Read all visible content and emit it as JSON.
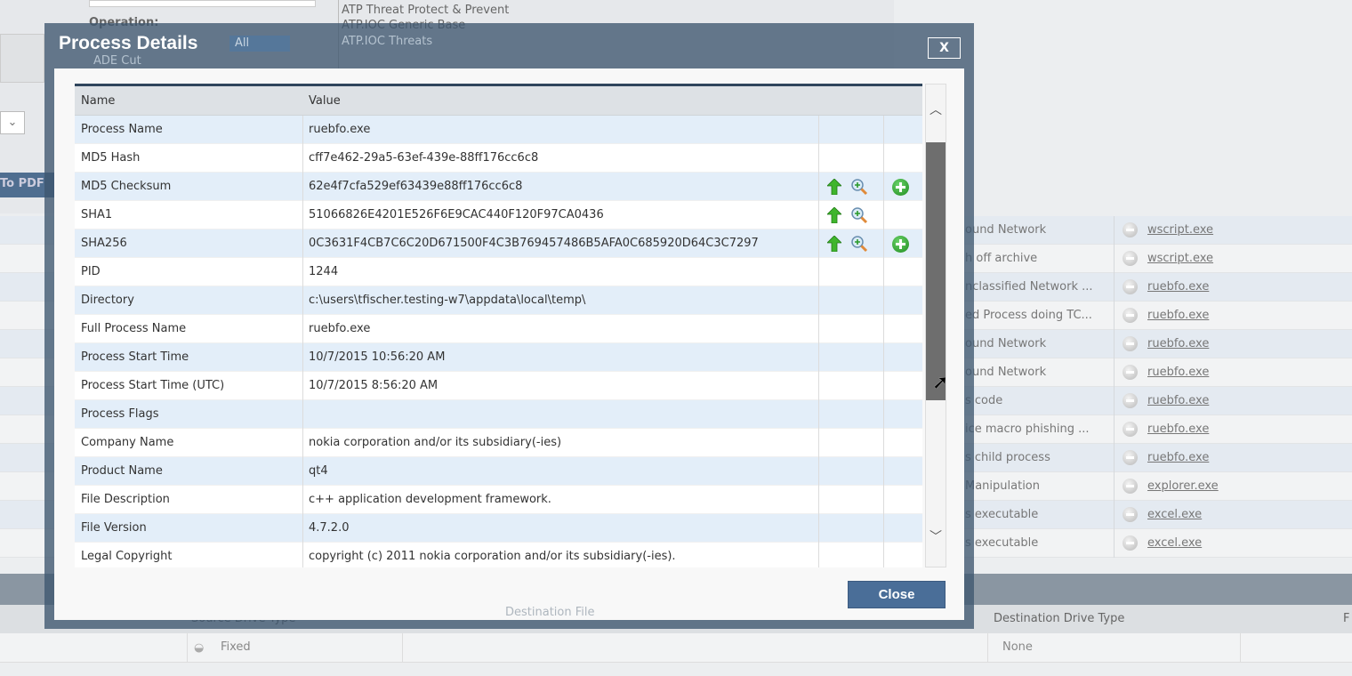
{
  "background": {
    "policies": [
      "ATP Threat Protect & Prevent",
      "ATP.IOC Generic Base",
      "ATP.IOC Threats"
    ],
    "operation_label": "Operation:",
    "operation_options": [
      "All",
      "ADE Cut"
    ],
    "export_button": "To PDF",
    "events": [
      {
        "rule": "ound Network",
        "process": "wscript.exe"
      },
      {
        "rule": "h off archive",
        "process": "wscript.exe"
      },
      {
        "rule": "nclassified Network ...",
        "process": "ruebfo.exe"
      },
      {
        "rule": "ed Process doing TC...",
        "process": "ruebfo.exe"
      },
      {
        "rule": "ound Network",
        "process": "ruebfo.exe"
      },
      {
        "rule": "ound Network",
        "process": "ruebfo.exe"
      },
      {
        "rule": "s code",
        "process": "ruebfo.exe"
      },
      {
        "rule": "ice macro phishing ...",
        "process": "ruebfo.exe"
      },
      {
        "rule": "s child process",
        "process": "ruebfo.exe"
      },
      {
        "rule": "Manipulation",
        "process": "explorer.exe"
      },
      {
        "rule": "s executable",
        "process": "excel.exe"
      },
      {
        "rule": "s executable",
        "process": "excel.exe"
      }
    ],
    "detail_headers": {
      "source_drive_type": "Source Drive Type",
      "destination_file": "Destination File",
      "destination_drive_type": "Destination Drive Type",
      "f": "F"
    },
    "detail_row": {
      "source_drive_type": "Fixed",
      "destination_drive_type": "None"
    }
  },
  "dialog": {
    "title": "Process Details",
    "close_x": "X",
    "columns": {
      "name": "Name",
      "value": "Value"
    },
    "rows": [
      {
        "name": "Process Name",
        "value": "ruebfo.exe"
      },
      {
        "name": "MD5 Hash",
        "value": "cff7e462-29a5-63ef-439e-88ff176cc6c8"
      },
      {
        "name": "MD5 Checksum",
        "value": "62e4f7cfa529ef63439e88ff176cc6c8",
        "icons": [
          "up-arrow-icon",
          "magnify-icon",
          "add-icon"
        ]
      },
      {
        "name": "SHA1",
        "value": "51066826E4201E526F6E9CAC440F120F97CA0436",
        "icons": [
          "up-arrow-icon",
          "magnify-icon"
        ]
      },
      {
        "name": "SHA256",
        "value": "0C3631F4CB7C6C20D671500F4C3B769457486B5AFA0C685920D64C3C7297",
        "icons": [
          "up-arrow-icon",
          "magnify-icon",
          "add-icon"
        ]
      },
      {
        "name": "PID",
        "value": "1244"
      },
      {
        "name": "Directory",
        "value": "c:\\users\\tfischer.testing-w7\\appdata\\local\\temp\\"
      },
      {
        "name": "Full Process Name",
        "value": "ruebfo.exe"
      },
      {
        "name": "Process Start Time",
        "value": "10/7/2015 10:56:20 AM"
      },
      {
        "name": "Process Start Time (UTC)",
        "value": "10/7/2015 8:56:20 AM"
      },
      {
        "name": "Process Flags",
        "value": ""
      },
      {
        "name": "Company Name",
        "value": "nokia corporation and/or its subsidiary(-ies)"
      },
      {
        "name": "Product Name",
        "value": "qt4"
      },
      {
        "name": "File Description",
        "value": "c++ application development framework."
      },
      {
        "name": "File Version",
        "value": "4.7.2.0"
      },
      {
        "name": "Legal Copyright",
        "value": "copyright (c) 2011 nokia corporation and/or its subsidiary(-ies)."
      }
    ],
    "close_button": "Close"
  }
}
